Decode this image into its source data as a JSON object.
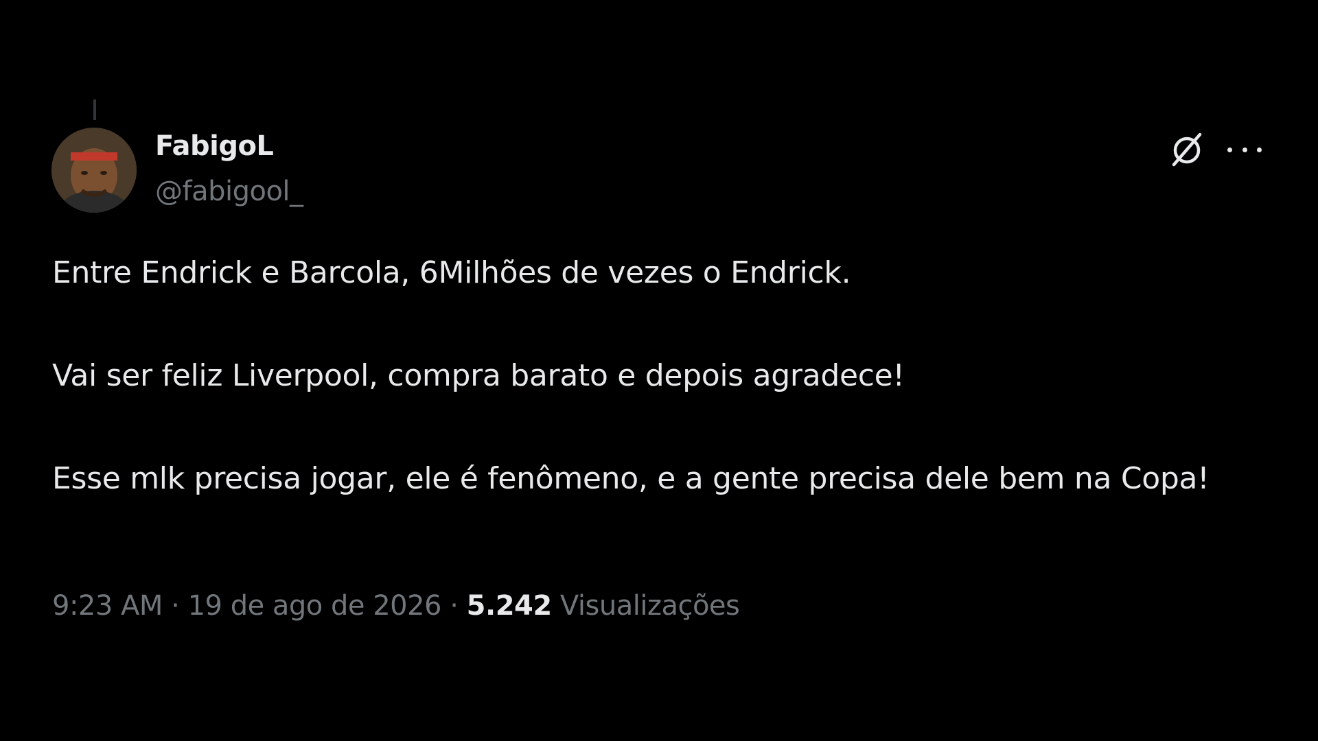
{
  "tweet": {
    "author": {
      "display_name": "FabigoL",
      "handle": "@fabigool_"
    },
    "paragraphs": [
      "Entre Endrick e Barcola, 6Milhões de vezes o Endrick.",
      "Vai ser feliz Liverpool, compra barato e depois agradece!",
      "Esse mlk precisa jogar, ele é fenômeno, e a gente precisa dele bem na Copa!"
    ],
    "time": "9:23 AM",
    "separator": "·",
    "date": "19 de ago de 2026",
    "views_count": "5.242",
    "views_label": "Visualizações"
  },
  "icons": {
    "grok": "grok-icon",
    "more": "more-icon",
    "avatar": "avatar"
  },
  "colors": {
    "background": "#000000",
    "primary_text": "#e7e9ea",
    "secondary_text": "#71767b"
  }
}
